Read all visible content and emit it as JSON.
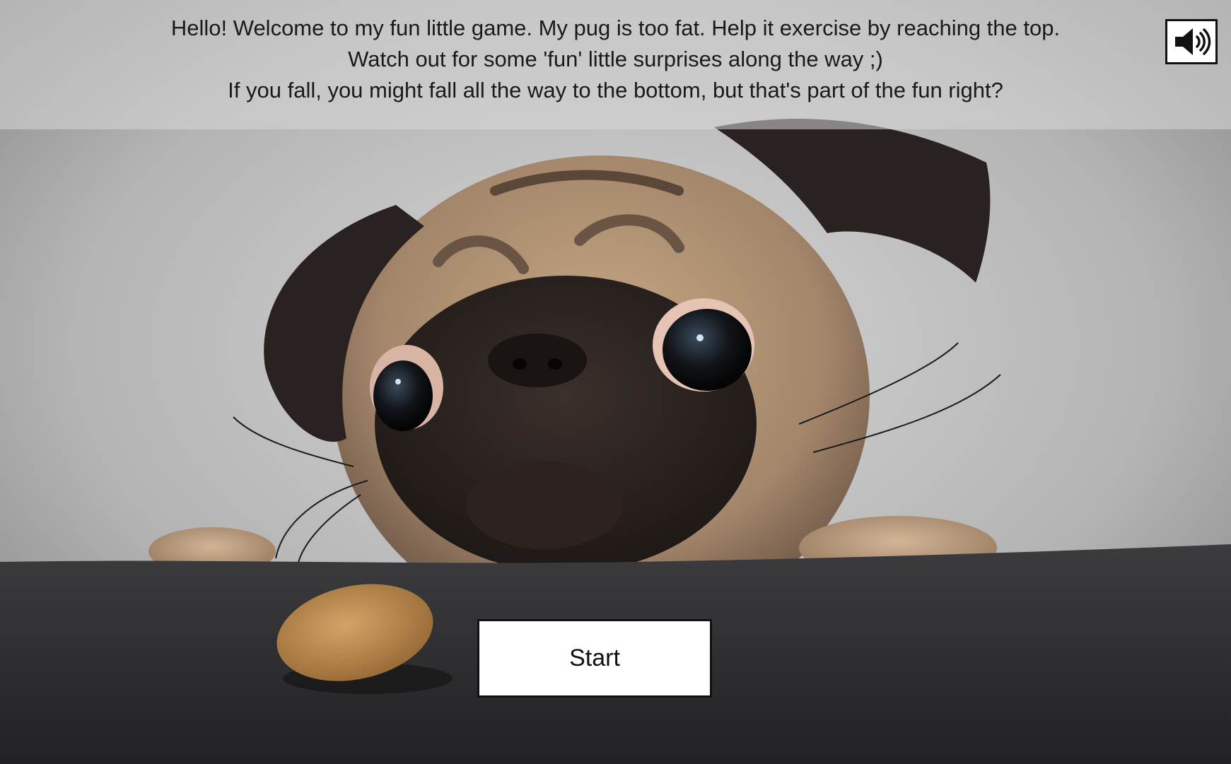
{
  "intro": {
    "line1": "Hello! Welcome to my fun little game. My pug is too fat. Help it exercise by reaching the top.",
    "line2": "Watch out for some 'fun' little surprises along the way ;)",
    "line3": "If you fall, you might fall all the way to the bottom, but that's part of the fun right?"
  },
  "sound_toggle": {
    "icon": "speaker-volume-icon"
  },
  "start": {
    "label": "Start"
  },
  "colors": {
    "panel": "#d7d7d7",
    "button_bg": "#ffffff",
    "button_border": "#111111",
    "table_surface": "#2e2e30",
    "pug_fawn": "#b89a78",
    "pug_mask": "#2a2220",
    "treat": "#b8894a"
  }
}
